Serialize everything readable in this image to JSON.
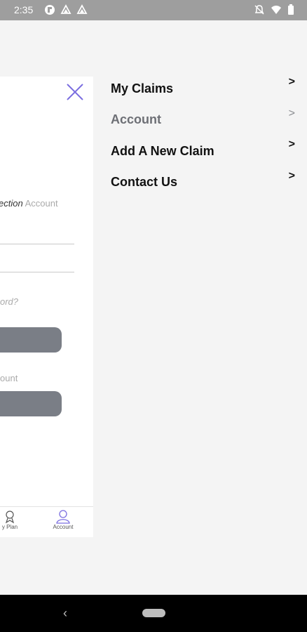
{
  "status_bar": {
    "time": "2:35",
    "left_icons": [
      "flipboard-icon",
      "drive-icon",
      "drive-icon"
    ],
    "right_icons": [
      "notifications-off-icon",
      "wifi-icon",
      "battery-icon"
    ]
  },
  "background_screen": {
    "text_connection": "ection",
    "text_account": "Account",
    "text_forgot": "ord?",
    "text_create": "ount",
    "tabs": [
      {
        "label": "y Plan",
        "icon": "plan-icon"
      },
      {
        "label": "Account",
        "icon": "account-icon"
      }
    ]
  },
  "menu": {
    "items": [
      {
        "label": "My Claims",
        "chevron": ">",
        "active": false
      },
      {
        "label": "Account",
        "chevron": ">",
        "active": true
      },
      {
        "label": "Add A New Claim",
        "chevron": ">",
        "active": false
      },
      {
        "label": "Contact Us",
        "chevron": ">",
        "active": false
      }
    ]
  },
  "nav_bar": {
    "back_glyph": "‹"
  }
}
